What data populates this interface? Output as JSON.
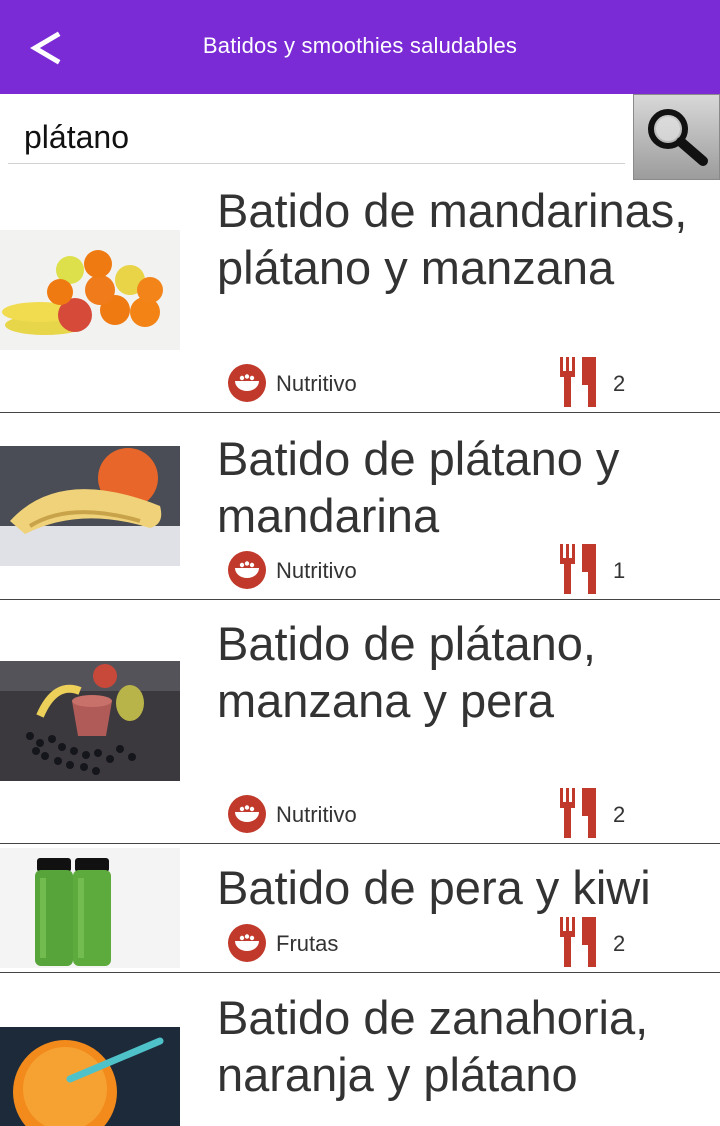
{
  "appbar": {
    "back_label": "<",
    "title": "Batidos y smoothies saludables"
  },
  "search": {
    "value": "plátano",
    "placeholder": ""
  },
  "recipes": [
    {
      "title": "Batido de mandarinas, plátano y manzana",
      "category": "Nutritivo",
      "servings": "2",
      "image": "fruit-pile-photo"
    },
    {
      "title": "Batido de plátano y mandarina",
      "category": "Nutritivo",
      "servings": "1",
      "image": "banana-orange-photo"
    },
    {
      "title": "Batido de plátano, manzana y pera",
      "category": "Nutritivo",
      "servings": "2",
      "image": "smoothie-glass-photo"
    },
    {
      "title": "Batido de pera y kiwi",
      "category": "Frutas",
      "servings": "2",
      "image": "green-bottles-photo"
    },
    {
      "title": "Batido de zanahoria, naranja y plátano",
      "category": "",
      "servings": "",
      "image": "orange-drink-photo"
    }
  ],
  "icons": {
    "category": "bowl-icon",
    "servings": "fork-knife-icon",
    "search": "search-icon",
    "back": "back-arrow-icon"
  },
  "colors": {
    "appbar": "#7a2bd6",
    "accent_red": "#c0392b"
  }
}
